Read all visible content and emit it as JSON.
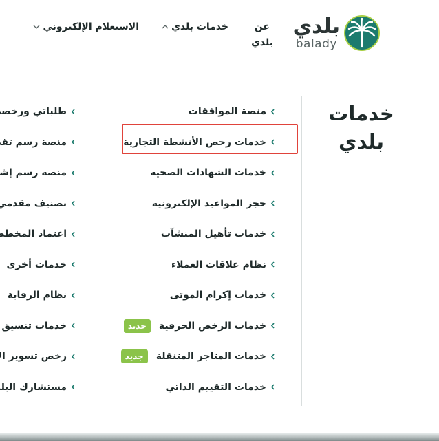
{
  "brand": {
    "name_ar": "بلدي",
    "name_en": "balady",
    "accent_color": "#1c7b6e",
    "emblem_icon": "palm-emblem-icon"
  },
  "nav": {
    "about_line1": "عن",
    "about_line2": "بلدي",
    "services": "خدمات بلدي",
    "inquiry": "الاستعلام الإلكتروني"
  },
  "section": {
    "title_line1": "خدمات",
    "title_line2": "بلدي"
  },
  "badge_color": "#8bc34a",
  "highlight_color": "#e0433b",
  "column1": [
    {
      "label": "منصة الموافقات",
      "badge": ""
    },
    {
      "label": "خدمات رخص الأنشطة التجارية",
      "badge": ""
    },
    {
      "label": "خدمات الشهادات الصحية",
      "badge": ""
    },
    {
      "label": "حجز المواعيد الإلكترونية",
      "badge": ""
    },
    {
      "label": "خدمات تأهيل المنشآت",
      "badge": ""
    },
    {
      "label": "نظام علاقات العملاء",
      "badge": ""
    },
    {
      "label": "خدمات إكرام الموتى",
      "badge": ""
    },
    {
      "label": "خدمات الرخص الحرفية",
      "badge": "جديد"
    },
    {
      "label": "خدمات المتاجر المتنقلة",
      "badge": "جديد"
    },
    {
      "label": "خدمات التقييم الذاتي",
      "badge": ""
    }
  ],
  "column2": [
    {
      "label": "طلباتي ورخصي",
      "badge": ""
    },
    {
      "label": "منصة رسم تقديم",
      "badge": ""
    },
    {
      "label": "منصة رسم إشغال",
      "badge": ""
    },
    {
      "label": "تصنيف مقدمي",
      "badge": ""
    },
    {
      "label": "اعتماد المخططات",
      "badge": ""
    },
    {
      "label": "خدمات أخرى",
      "badge": ""
    },
    {
      "label": "نظام الرقابة",
      "badge": ""
    },
    {
      "label": "خدمات تنسيق الم",
      "badge": ""
    },
    {
      "label": "رخص تسوير الأرا",
      "badge": ""
    },
    {
      "label": "مستشارك البلدي",
      "badge": ""
    }
  ]
}
